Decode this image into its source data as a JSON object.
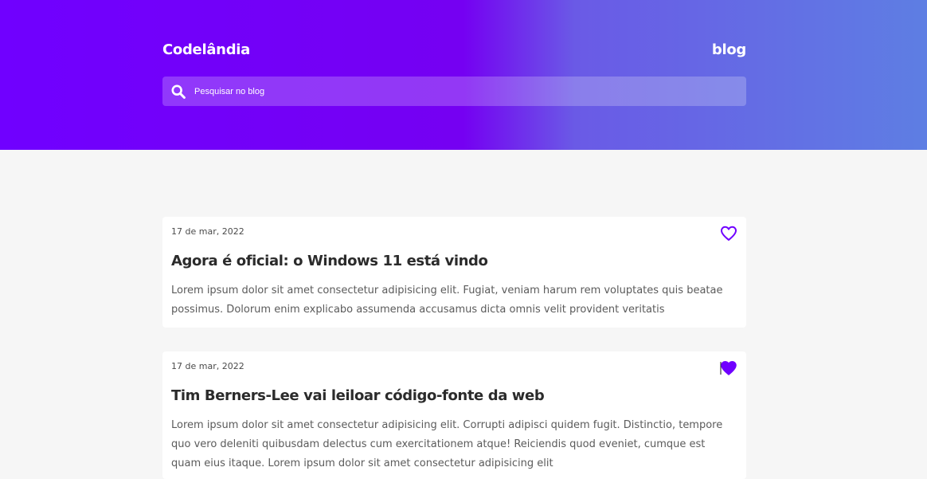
{
  "header": {
    "logo": "Codelândia",
    "nav_blog": "blog",
    "search_placeholder": "Pesquisar no blog",
    "search_icon": "search-icon"
  },
  "colors": {
    "accent": "#7000ff",
    "gradient_end": "#5e7ee3",
    "background": "#f6f6f6",
    "card": "#ffffff"
  },
  "posts": [
    {
      "date": "17 de mar, 2022",
      "title": "Agora é oficial: o Windows 11 está vindo",
      "excerpt": "Lorem ipsum dolor sit amet consectetur adipisicing elit. Fugiat, veniam harum rem voluptates quis beatae possimus. Dolorum enim explicabo assumenda accusamus dicta omnis velit provident veritatis",
      "liked": false,
      "like_icon": "heart-outline-icon"
    },
    {
      "date": "17 de mar, 2022",
      "title": "Tim Berners-Lee vai leiloar código-fonte da web",
      "excerpt": "Lorem ipsum dolor sit amet consectetur adipisicing elit. Corrupti adipisci quidem fugit. Distinctio, tempore quo vero deleniti quibusdam delectus cum exercitationem atque! Reiciendis quod eveniet, cumque est quam eius itaque. Lorem ipsum dolor sit amet consectetur adipisicing elit",
      "liked": true,
      "like_icon": "heart-filled-icon"
    }
  ]
}
